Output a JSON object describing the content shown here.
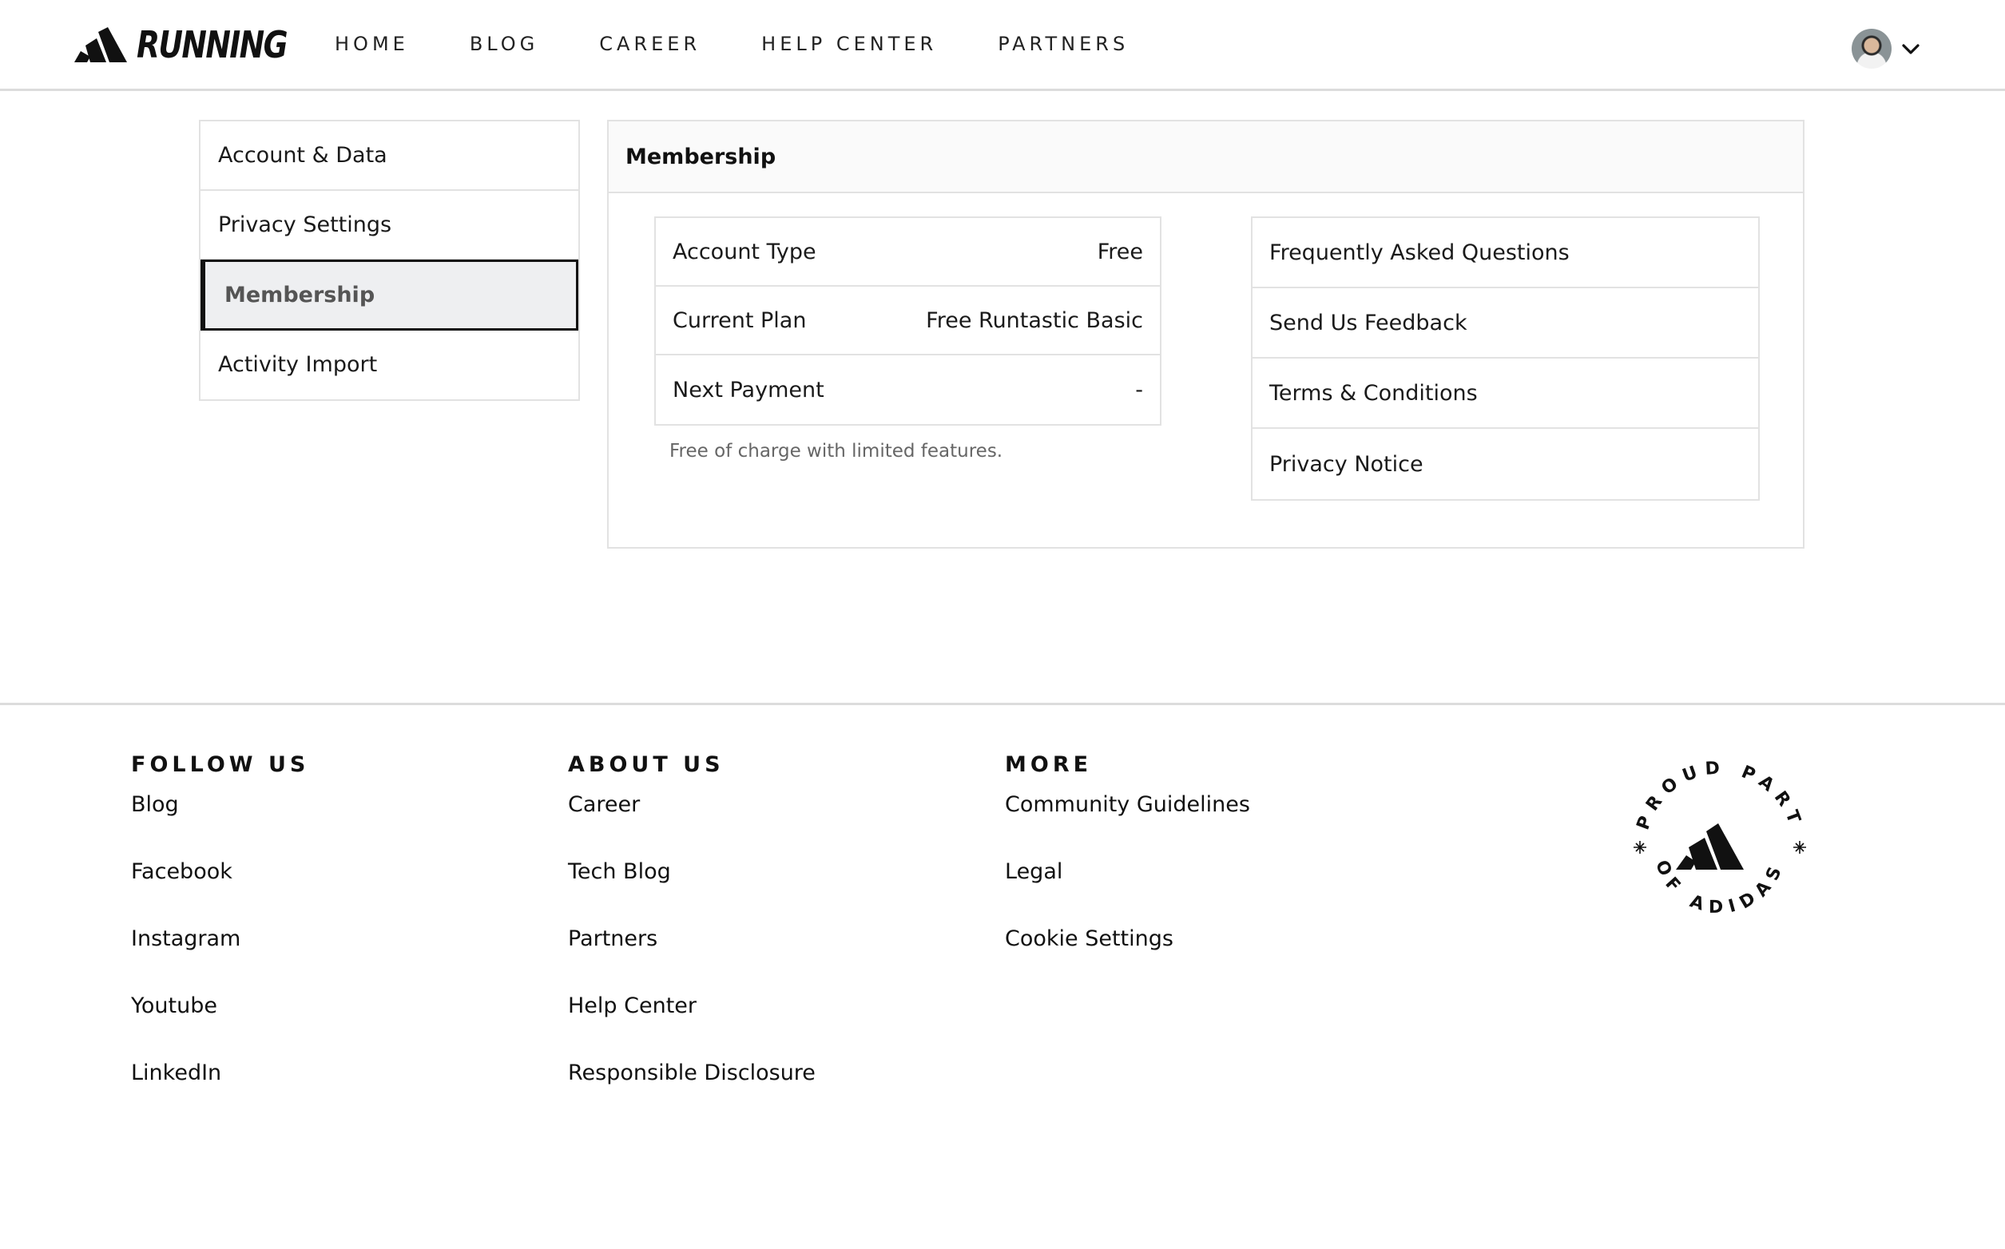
{
  "header": {
    "brand": "RUNNING",
    "nav": [
      "HOME",
      "BLOG",
      "CAREER",
      "HELP CENTER",
      "PARTNERS"
    ]
  },
  "sidebar": {
    "items": [
      {
        "label": "Account & Data"
      },
      {
        "label": "Privacy Settings"
      },
      {
        "label": "Membership",
        "active": true
      },
      {
        "label": "Activity Import"
      }
    ]
  },
  "panel": {
    "title": "Membership",
    "details": [
      {
        "label": "Account Type",
        "value": "Free"
      },
      {
        "label": "Current Plan",
        "value": "Free Runtastic Basic"
      },
      {
        "label": "Next Payment",
        "value": "-"
      }
    ],
    "note": "Free of charge with limited features.",
    "links": [
      "Frequently Asked Questions",
      "Send Us Feedback",
      "Terms & Conditions",
      "Privacy Notice"
    ]
  },
  "footer": {
    "columns": [
      {
        "title": "FOLLOW US",
        "links": [
          "Blog",
          "Facebook",
          "Instagram",
          "Youtube",
          "LinkedIn"
        ]
      },
      {
        "title": "ABOUT US",
        "links": [
          "Career",
          "Tech Blog",
          "Partners",
          "Help Center",
          "Responsible Disclosure"
        ]
      },
      {
        "title": "MORE",
        "links": [
          "Community Guidelines",
          "Legal",
          "Cookie Settings"
        ]
      }
    ],
    "badge": {
      "top_text": "PROUD PART",
      "bottom_text": "OF ADIDAS"
    }
  },
  "colors": {
    "accent": "#111111",
    "border": "#e2e2e2",
    "active_bg": "#eeeff1"
  }
}
